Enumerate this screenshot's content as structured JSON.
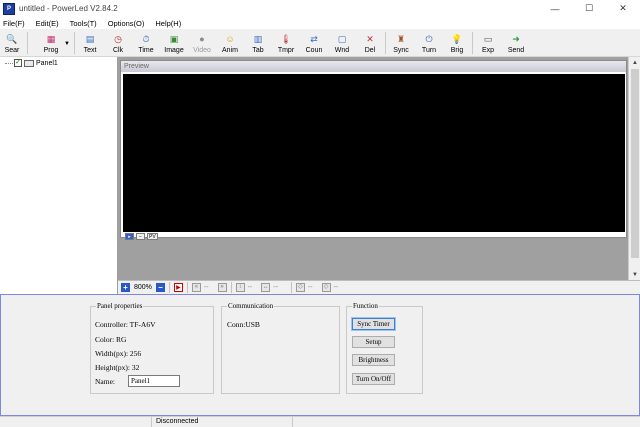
{
  "window": {
    "title": "untitled - PowerLed V2.84.2",
    "app_icon": "powerled-app-icon",
    "controls": {
      "minimize": "—",
      "maximize": "☐",
      "close": "✕"
    }
  },
  "menu": {
    "items": [
      {
        "label": "File(F)"
      },
      {
        "label": "Edit(E)"
      },
      {
        "label": "Tools(T)"
      },
      {
        "label": "Options(O)"
      },
      {
        "label": "Help(H)"
      }
    ]
  },
  "toolbar": {
    "items": [
      {
        "label": "Sear",
        "icon": "🔍",
        "color": "#3a6bbf"
      },
      {
        "label": "Prog",
        "icon": "▦",
        "color": "#c0306e"
      },
      {
        "label": "Text",
        "icon": "▤",
        "color": "#3a6bbf"
      },
      {
        "label": "Clk",
        "icon": "◷",
        "color": "#c03030"
      },
      {
        "label": "Time",
        "icon": "⏱",
        "color": "#3a6bbf"
      },
      {
        "label": "Image",
        "icon": "▣",
        "color": "#3a8a3a"
      },
      {
        "label": "Video",
        "icon": "●",
        "color": "#8a8a8a"
      },
      {
        "label": "Anim",
        "icon": "☺",
        "color": "#d9a020"
      },
      {
        "label": "Tab",
        "icon": "▥",
        "color": "#3a6bbf"
      },
      {
        "label": "Tmpr",
        "icon": "🌡",
        "color": "#c03030"
      },
      {
        "label": "Coun",
        "icon": "⇄",
        "color": "#3a6bbf"
      },
      {
        "label": "Wnd",
        "icon": "▢",
        "color": "#3a6bbf"
      },
      {
        "label": "Del",
        "icon": "✕",
        "color": "#c03030"
      },
      {
        "label": "Sync",
        "icon": "♜",
        "color": "#a05020"
      },
      {
        "label": "Turn",
        "icon": "⏻",
        "color": "#3a6bbf"
      },
      {
        "label": "Brig",
        "icon": "💡",
        "color": "#d9a020"
      },
      {
        "label": "Exp",
        "icon": "▭",
        "color": "#555555"
      },
      {
        "label": "Send",
        "icon": "➜",
        "color": "#2a9a3a"
      }
    ]
  },
  "tree": {
    "panel_label": "Panel1",
    "checked": "✓"
  },
  "preview": {
    "title": "Preview",
    "tools": [
      "▸",
      "−",
      "PV"
    ]
  },
  "zoombar": {
    "plus": "+",
    "zoom": "800%",
    "minus": "−",
    "record": "▶",
    "dash": "--"
  },
  "panel_properties": {
    "legend": "Panel properties",
    "controller": "Controller: TF-A6V",
    "color": "Color: RG",
    "width": "Width(px): 256",
    "height": "Height(px): 32",
    "name_label": "Name:",
    "name_value": "Panel1"
  },
  "communication": {
    "legend": "Communication",
    "conn": "Conn:USB"
  },
  "function": {
    "legend": "Function",
    "sync_timer": "Sync Timer",
    "setup": "Setup",
    "brightness": "Brightness",
    "turn_on_off": "Turn On/Off"
  },
  "status": {
    "connection": "Disconnected"
  },
  "colors": {
    "accent_border": "#7d88e0",
    "preview_screen": "#000000",
    "workspace": "#a0a0a0"
  }
}
